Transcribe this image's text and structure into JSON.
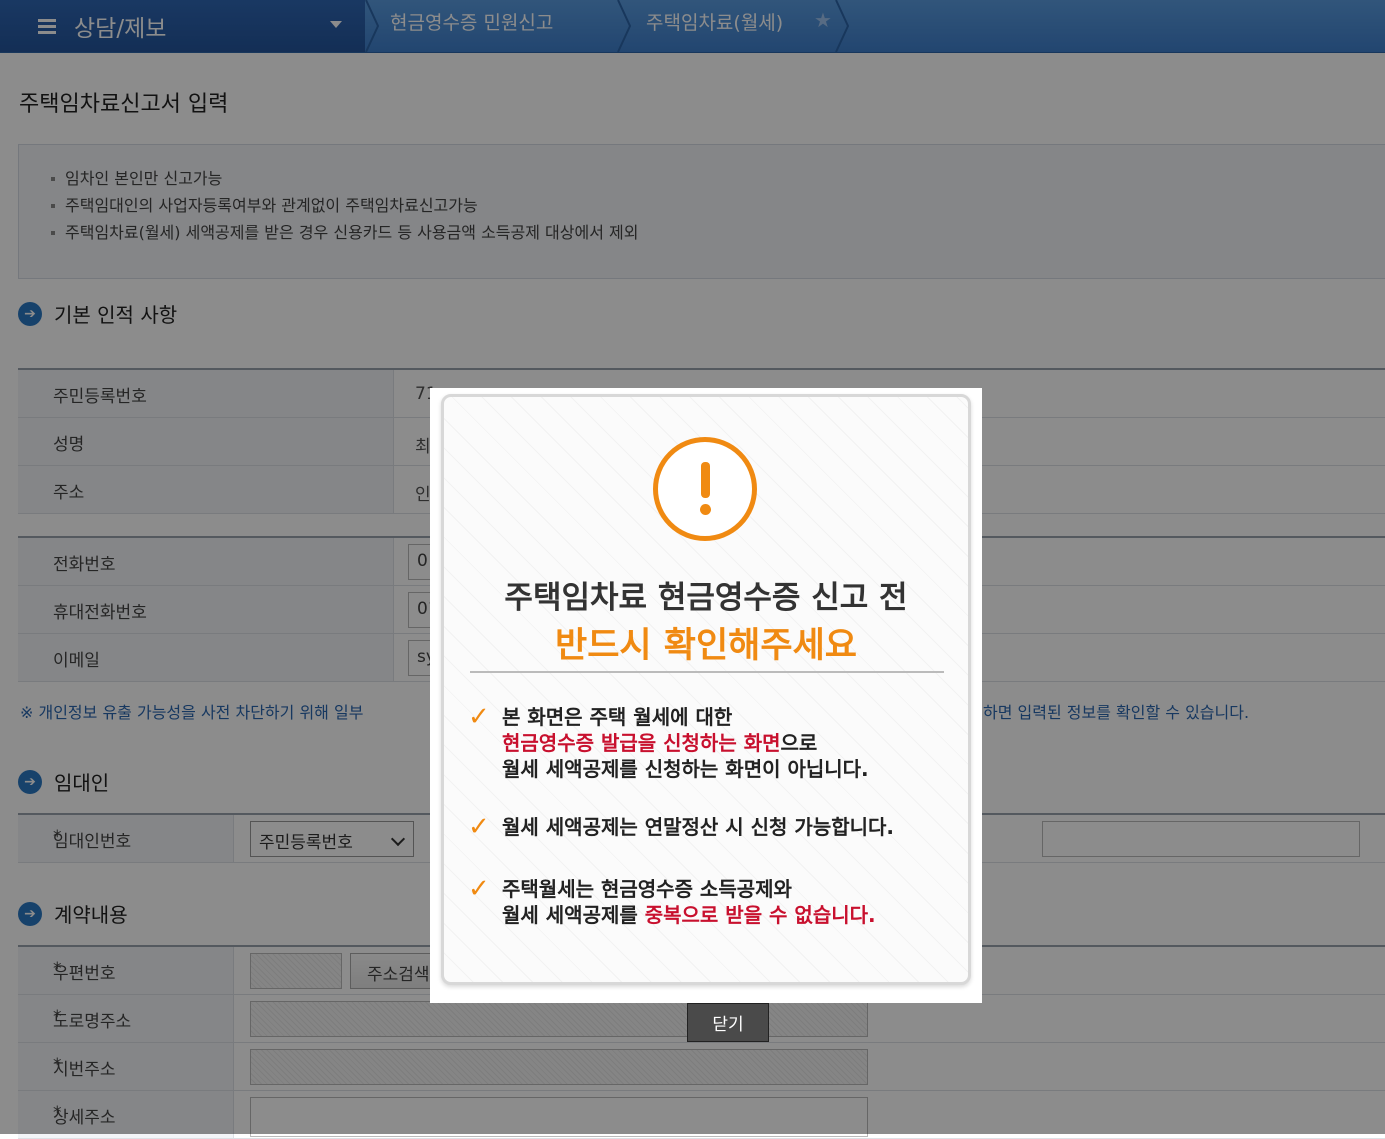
{
  "header": {
    "menu_label": "상담/제보",
    "crumb1": "현금영수증 민원신고",
    "crumb2": "주택임차료(월세)"
  },
  "page": {
    "title": "주택임차료신고서 입력",
    "notices": [
      "임차인 본인만 신고가능",
      "주택임대인의 사업자등록여부와 관계없이 주택임차료신고가능",
      "주택임차료(월세) 세액공제를 받은 경우 신용카드 등 사용금액 소득공제 대상에서 제외"
    ]
  },
  "basic": {
    "section_title": "기본 인적 사항",
    "rows": [
      {
        "label": "주민등록번호",
        "value": "71"
      },
      {
        "label": "성명",
        "value": "최"
      },
      {
        "label": "주소",
        "value": "인"
      }
    ],
    "contact_rows": [
      {
        "label": "전화번호",
        "value": "0"
      },
      {
        "label": "휴대전화번호",
        "value": "01"
      },
      {
        "label": "이메일",
        "value": "sy"
      }
    ],
    "privacy_left": "※ 개인정보 유출 가능성을 사전 차단하기 위해 일부",
    "privacy_right": "하면 입력된 정보를 확인할 수 있습니다."
  },
  "landlord": {
    "section_title": "임대인",
    "id_label": "임대인번호",
    "id_type": "주민등록번호"
  },
  "contract": {
    "section_title": "계약내용",
    "postal_label": "우편번호",
    "search_btn": "주소검색",
    "road_label": "도로명주소",
    "lot_label": "지번주소",
    "detail_label": "상세주소"
  },
  "modal": {
    "title1": "주택임차료 현금영수증 신고 전",
    "title2": "반드시 확인해주세요",
    "item1_line1": "본 화면은 주택 월세에 대한",
    "item1_line2_red": "현금영수증 발급을 신청하는 화면",
    "item1_line2_rest": "으로",
    "item1_line3": "월세 세액공제를 신청하는 화면이 아닙니다.",
    "item2": "월세 세액공제는 연말정산 시 신청 가능합니다.",
    "item3_line1": "주택월세는 현금영수증 소득공제와",
    "item3_line2_pre": "월세 세액공제를 ",
    "item3_line2_red": "중복으로 받을 수 없습니다.",
    "close_label": "닫기"
  },
  "colors": {
    "accent": "#f08a12",
    "brand": "#3f7fcc",
    "alert_red": "#c8102e"
  }
}
